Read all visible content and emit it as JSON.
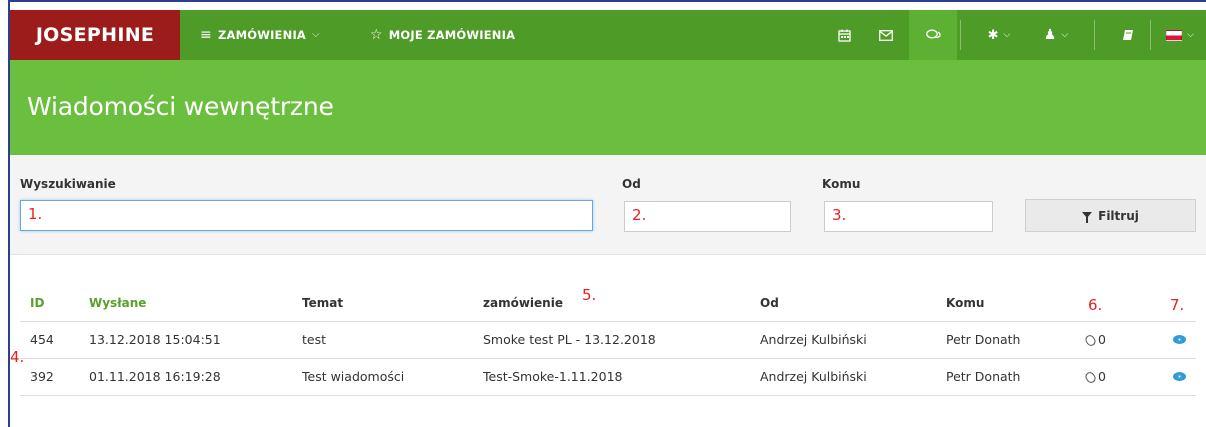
{
  "topbar": {
    "brand": "JOSEPHINE",
    "orders_label": "ZAMÓWIENIA",
    "orders_icon": "menu-icon",
    "my_orders_label": "MOJE ZAMÓWIENIA",
    "my_orders_icon": "star-icon",
    "right_icons": [
      "calendar-icon",
      "mail-icon",
      "chat-icon",
      "gear-icon",
      "user-icon",
      "book-icon",
      "flag-pl-icon"
    ],
    "colors": {
      "bar": "#4f9b27",
      "brand_bg": "#9c1c1c",
      "active": "#5cb135"
    }
  },
  "page": {
    "title": "Wiadomości wewnętrzne",
    "header_color": "#6bbf3e"
  },
  "filters": {
    "search_label": "Wyszukiwanie",
    "search_value": "1.",
    "from_label": "Od",
    "from_value": "2.",
    "to_label": "Komu",
    "to_value": "3.",
    "filter_button": "Filtruj"
  },
  "table": {
    "headers": {
      "id": "ID",
      "sent": "Wysłane",
      "subject": "Temat",
      "order": "zamówienie",
      "from": "Od",
      "to": "Komu"
    },
    "rows": [
      {
        "id": "454",
        "sent": "13.12.2018 15:04:51",
        "subject": "test",
        "order": "Smoke test PL - 13.12.2018",
        "from": "Andrzej Kulbiński",
        "to": "Petr Donath",
        "attachments": "0"
      },
      {
        "id": "392",
        "sent": "01.11.2018 16:19:28",
        "subject": "Test wiadomości",
        "order": "Test-Smoke-1.11.2018",
        "from": "Andrzej Kulbiński",
        "to": "Petr Donath",
        "attachments": "0"
      }
    ]
  },
  "annotations": {
    "a4": "4.",
    "a5": "5.",
    "a6": "6.",
    "a7": "7."
  }
}
